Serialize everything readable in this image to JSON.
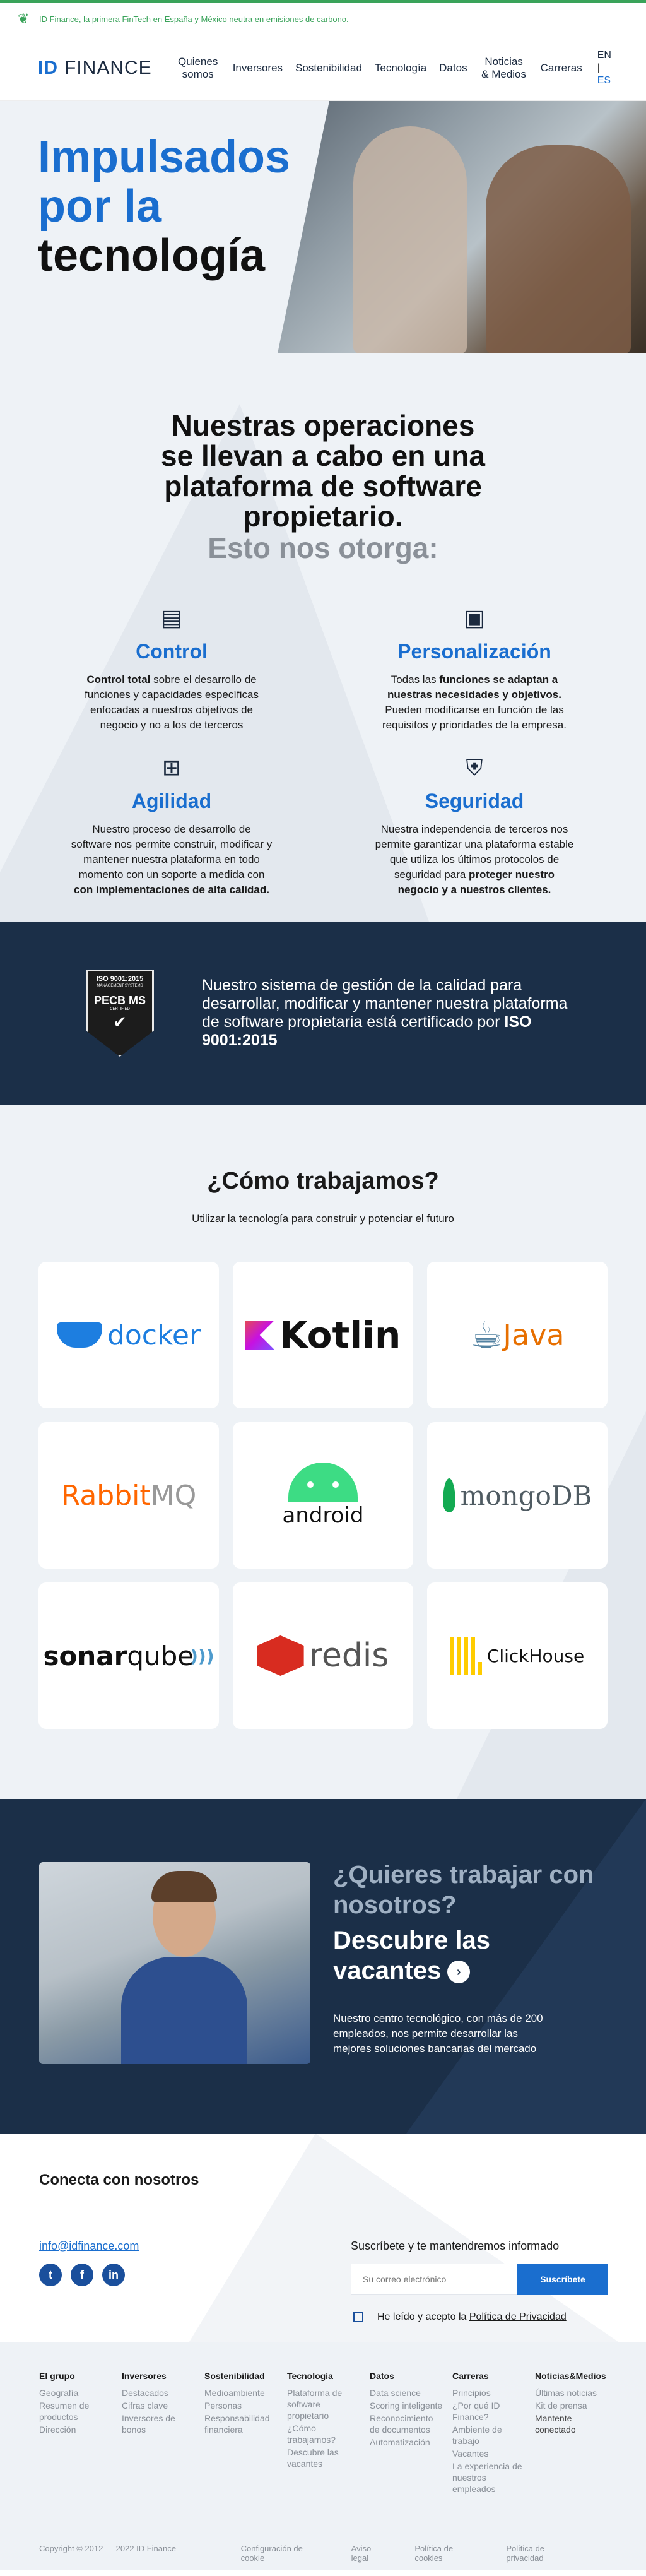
{
  "topbar": {
    "message": "ID Finance, la primera FinTech en España y México neutra en emisiones de carbono."
  },
  "nav": {
    "logo_id": "ID",
    "logo_text": "FINANCE",
    "links": [
      "Quienes somos",
      "Inversores",
      "Sostenibilidad",
      "Tecnología",
      "Datos",
      "Noticias & Medios",
      "Carreras"
    ],
    "lang_en": "EN",
    "lang_es": "ES"
  },
  "hero": {
    "line1": "Impulsados",
    "line2": "por la",
    "line3": "tecnología"
  },
  "ops": {
    "title": "Nuestras operaciones se llevan a cabo en una plataforma de software propietario.",
    "subtitle": "Esto nos otorga:",
    "features": [
      {
        "title": "Control",
        "bold1": "Control total",
        "text1": " sobre el desarrollo de funciones y capacidades específicas enfocadas a nuestros objetivos de negocio y no a los de terceros",
        "bold2": "",
        "text2": ""
      },
      {
        "title": "Personalización",
        "text0": "Todas las ",
        "bold1": "funciones se adaptan a nuestras necesidades y objetivos.",
        "text1": " Pueden modificarse en función de las requisitos y prioridades de la empresa."
      },
      {
        "title": "Agilidad",
        "text0": "Nuestro proceso de desarrollo de software nos permite construir, modificar y mantener nuestra plataforma en todo momento con un soporte a medida con ",
        "bold1": "con implementaciones de alta calidad.",
        "text1": ""
      },
      {
        "title": "Seguridad",
        "text0": "Nuestra independencia de terceros nos permite garantizar una plataforma estable que utiliza los últimos protocolos de seguridad para ",
        "bold1": "proteger nuestro negocio y a nuestros clientes.",
        "text1": ""
      }
    ]
  },
  "iso": {
    "badge_line1": "ISO 9001:2015",
    "badge_line2": "MANAGEMENT SYSTEMS",
    "badge_line3": "PECB MS",
    "badge_line4": "CERTIFIED",
    "text": "Nuestro sistema de gestión de la calidad para desarrollar, modificar y mantener nuestra plataforma de software propietaria está certificado por ",
    "text_bold": "ISO 9001:2015"
  },
  "how": {
    "title": "¿Cómo trabajamos?",
    "lead": "Utilizar la tecnología para construir y potenciar el futuro",
    "tech": {
      "docker": "docker",
      "kotlin": "Kotlin",
      "java": "Java",
      "rabbit_a": "Rabbit",
      "rabbit_b": "MQ",
      "android": "android",
      "mongo": "mongoDB",
      "sonar_a": "sonar",
      "sonar_b": "qube",
      "redis": "redis",
      "clickhouse": "ClickHouse"
    }
  },
  "jobs": {
    "title": "¿Quieres trabajar con nosotros?",
    "cta": "Descubre las vacantes",
    "text": "Nuestro centro tecnológico, con más de 200 empleados, nos permite desarrollar las mejores soluciones bancarias del mercado"
  },
  "connect": {
    "title": "Conecta con nosotros",
    "email": "info@idfinance.com",
    "subscribe_title": "Suscríbete y te mantendremos informado",
    "input_placeholder": "Su correo electrónico",
    "subscribe_button": "Suscríbete",
    "consent_text": "He leído y acepto la ",
    "consent_link": "Política de Privacidad"
  },
  "footer": {
    "columns": [
      {
        "title": "El grupo",
        "links": [
          "Geografía",
          "Resumen de productos",
          "Dirección"
        ]
      },
      {
        "title": "Inversores",
        "links": [
          "Destacados",
          "Cifras clave",
          "Inversores de bonos"
        ]
      },
      {
        "title": "Sostenibilidad",
        "links": [
          "Medioambiente",
          "Personas",
          "Responsabilidad financiera"
        ]
      },
      {
        "title": "Tecnología",
        "links": [
          "Plataforma de software propietario",
          "¿Cómo trabajamos?",
          "Descubre las vacantes"
        ]
      },
      {
        "title": "Datos",
        "links": [
          "Data science",
          "Scoring inteligente",
          "Reconocimiento de documentos",
          "Automatización"
        ]
      },
      {
        "title": "Carreras",
        "links": [
          "Principios",
          "¿Por qué ID Finance?",
          "Ambiente de trabajo",
          "Vacantes",
          "La experiencia de nuestros empleados"
        ]
      },
      {
        "title": "Noticias&Medios",
        "links": [
          "Últimas noticias",
          "Kit de prensa",
          "Mantente conectado"
        ]
      }
    ],
    "copyright": "Copyright © 2012 — 2022 ID Finance",
    "legal": [
      "Configuración de cookie",
      "Aviso legal",
      "Política de cookies",
      "Política de privacidad"
    ]
  }
}
